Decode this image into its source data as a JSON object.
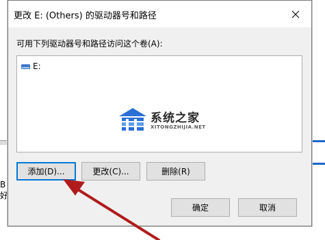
{
  "dialog": {
    "title": "更改 E: (Others) 的驱动器号和路径",
    "instruction": "可用下列驱动器号和路径访问这个卷(A):",
    "drives": [
      {
        "label": "E:"
      }
    ],
    "buttons": {
      "add": "添加(D)...",
      "change": "更改(C)...",
      "delete": "删除(R)",
      "ok": "确定",
      "cancel": "取消"
    },
    "close_icon": "close-icon"
  },
  "background_window": {
    "left_text_1": "B",
    "left_text_2": "好"
  },
  "watermark": {
    "title": "系统之家",
    "subtitle": "XITONGZHIJIA.NET"
  },
  "colors": {
    "focus": "#0078d7",
    "annotation_arrow": "#b01c1c",
    "drive_icon": "#3c78c8"
  }
}
